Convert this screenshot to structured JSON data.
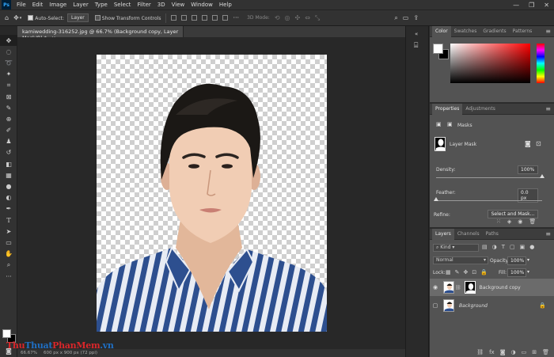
{
  "app": {
    "logo": "Ps"
  },
  "menu": [
    "File",
    "Edit",
    "Image",
    "Layer",
    "Type",
    "Select",
    "Filter",
    "3D",
    "View",
    "Window",
    "Help"
  ],
  "window_controls": [
    "—",
    "❐",
    "✕"
  ],
  "options_bar": {
    "auto_select_label": "Auto-Select:",
    "auto_select_checked": true,
    "auto_select_target": "Layer",
    "show_transform_label": "Show Transform Controls",
    "mode_3d_label": "3D Mode:"
  },
  "document": {
    "tab_title": "kamiwedding-316252.jpg @ 66.7% (Background copy, Layer Mask/8) *",
    "close_icon": "×",
    "status_zoom": "66.67%",
    "status_size": "600 px x 900 px (72 ppi)"
  },
  "color_panel": {
    "tabs": [
      "Color",
      "Swatches",
      "Gradients",
      "Patterns"
    ],
    "active": "Color",
    "fg": "#ffffff",
    "bg": "#000000"
  },
  "properties_panel": {
    "tabs": [
      "Properties",
      "Adjustments"
    ],
    "active": "Properties",
    "section": "Masks",
    "mask_title": "Layer Mask",
    "density_label": "Density:",
    "density_value": "100%",
    "density_level": 1.0,
    "feather_label": "Feather:",
    "feather_value": "0.0 px",
    "feather_level": 0.0,
    "refine_label": "Refine:",
    "select_mask_button": "Select and Mask..."
  },
  "layers_panel": {
    "tabs": [
      "Layers",
      "Channels",
      "Paths"
    ],
    "active": "Layers",
    "filter_kind": "Kind",
    "blend_mode": "Normal",
    "opacity_label": "Opacity:",
    "opacity_value": "100%",
    "lock_label": "Lock:",
    "fill_label": "Fill:",
    "fill_value": "100%",
    "layers": [
      {
        "name": "Background copy",
        "visible": true,
        "selected": true,
        "has_mask": true
      },
      {
        "name": "Background",
        "visible": false,
        "selected": false,
        "has_mask": false,
        "locked": true
      }
    ]
  },
  "watermark": {
    "part1": "Thu",
    "part2": "Thuat",
    "part3": "PhanMem",
    "part4": ".vn"
  },
  "colors": {
    "accent": "#31a8ff",
    "panel": "#535353",
    "bar": "#323232",
    "shirt_stripe": "#2d4f8f"
  }
}
